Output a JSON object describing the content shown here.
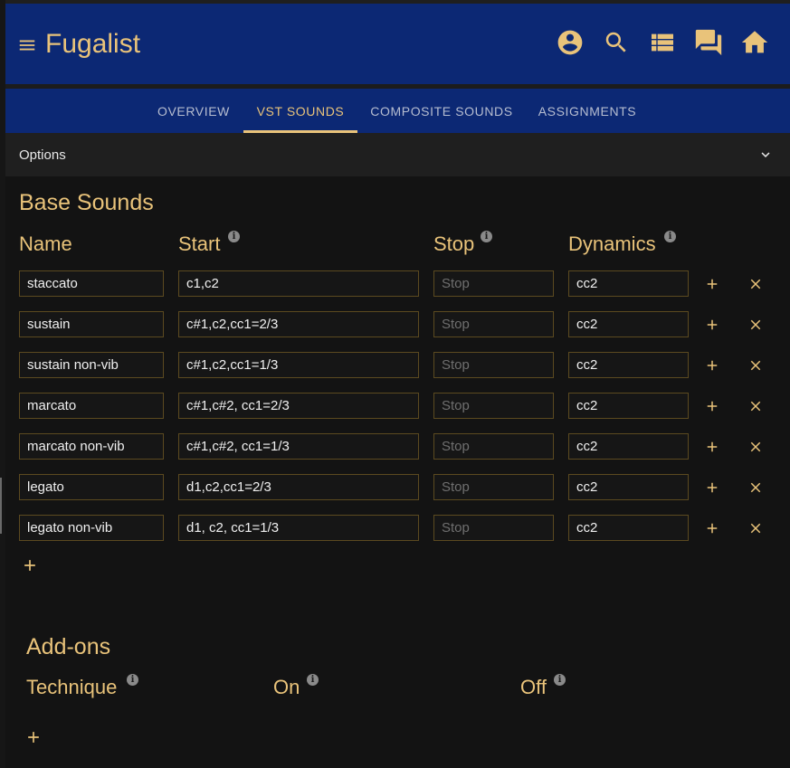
{
  "app": {
    "title": "Fugalist",
    "accent_color": "#e9c37a",
    "bar_color": "#0c2874",
    "menu_icon": "hamburger-menu-icon",
    "icons": [
      "account-circle-icon",
      "search-icon",
      "list-view-icon",
      "forum-icon",
      "home-icon"
    ]
  },
  "tabs": [
    "OVERVIEW",
    "VST SOUNDS",
    "COMPOSITE SOUNDS",
    "ASSIGNMENTS"
  ],
  "active_tab": "VST SOUNDS",
  "options": {
    "label": "Options",
    "icon": "chevron-down-icon"
  },
  "base_sounds": {
    "title": "Base Sounds",
    "headers": {
      "name": "Name",
      "start": "Start",
      "stop": "Stop",
      "dynamics": "Dynamics"
    },
    "stop_placeholder": "Stop",
    "rows": [
      {
        "name": "staccato",
        "start": "c1,c2",
        "stop": "",
        "dynamics": "cc2"
      },
      {
        "name": "sustain",
        "start": "c#1,c2,cc1=2/3",
        "stop": "",
        "dynamics": "cc2"
      },
      {
        "name": "sustain non-vib",
        "start": "c#1,c2,cc1=1/3",
        "stop": "",
        "dynamics": "cc2"
      },
      {
        "name": "marcato",
        "start": "c#1,c#2, cc1=2/3",
        "stop": "",
        "dynamics": "cc2"
      },
      {
        "name": "marcato non-vib",
        "start": "c#1,c#2, cc1=1/3",
        "stop": "",
        "dynamics": "cc2"
      },
      {
        "name": "legato",
        "start": "d1,c2,cc1=2/3",
        "stop": "",
        "dynamics": "cc2"
      },
      {
        "name": "legato non-vib",
        "start": "d1, c2, cc1=1/3",
        "stop": "",
        "dynamics": "cc2"
      }
    ]
  },
  "addons": {
    "title": "Add-ons",
    "headers": {
      "technique": "Technique",
      "on": "On",
      "off": "Off"
    }
  }
}
